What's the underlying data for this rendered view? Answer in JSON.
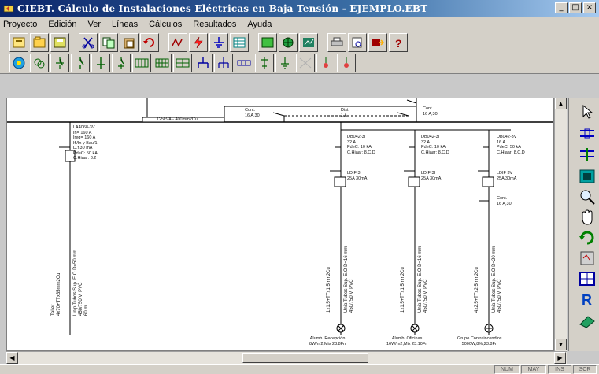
{
  "window": {
    "title": "CIEBT. Cálculo de Instalaciones Eléctricas en Baja Tensión - EJEMPLO.EBT",
    "buttons": {
      "minimize": "_",
      "maximize": "□",
      "close": "×"
    }
  },
  "menu": {
    "items": [
      "Proyecto",
      "Edición",
      "Ver",
      "Líneas",
      "Cálculos",
      "Resultados",
      "Ayuda"
    ]
  },
  "toolbar1": {
    "icons": [
      "new-doc-icon",
      "open-icon",
      "save-icon",
      "cut-icon",
      "copy-icon",
      "paste-icon",
      "undo-icon",
      "calc-icon",
      "lightning-icon",
      "ground-icon",
      "table-icon",
      "grid-icon",
      "globe-icon",
      "chart-icon",
      "print-icon",
      "preview-icon",
      "export-icon",
      "help-icon"
    ]
  },
  "toolbar2": {
    "icons": [
      "supply-icon",
      "transformer-icon",
      "switch-icon",
      "breaker-icon",
      "fuse-icon",
      "diff-icon",
      "panel-icon",
      "panel2-icon",
      "panel3-icon",
      "motor-icon",
      "motor2-icon",
      "bus-icon",
      "line-icon",
      "ground2-icon",
      "disabled-icon",
      "lamp-icon",
      "lamp2-icon"
    ]
  },
  "diagram": {
    "bus_label": "125kVA - 400mm2Cu",
    "cont_label_1": "Cont.\n16 A,30",
    "cont_label_2": "Cont.\n16 A,30",
    "dist_label": "Dist.\n1 A",
    "main_breaker": "LA4068-3V\nIn= 160 A\nIreg= 160 A\nIfi/In y Bau/1\nD.f.30 mA\nPdeC: 50 kA\nC.Hiaar: 8.2",
    "branch1_breaker": "DB042-3I\n32 A\nPdeC: 10 kA\nC.Hiaar: 8.C.D",
    "branch1_diff": "LDIF 3I\n25A 30mA",
    "branch2_breaker": "DB042-3I\n32 A\nPdeC: 10 kA\nC.Hiaar: 8.C.D",
    "branch2_diff": "LDIF 3I\n25A 30mA",
    "branch3_breaker": "DB042-3V\n16 A\nPdeC: 50 kA\nC.Hiaar: 8.C.D",
    "branch3_diff": "LDIF 3V\n25A 30mA",
    "branch3_cont": "Cont.\n16 A,30",
    "feeder_vertical_1": "Taller\n4x70+TTx35mm2Cu",
    "feeder_vertical_2": "Unip.Tubos Sup. E.O D=50 mm\n450/750 V, PVC\n60 m",
    "line_vertical_1": "1x1.5+TTx1.5mm2Cu",
    "line_vertical_2": "Unip.Tubos Sup. E.O D=16 mm\n450/750 V, PVC",
    "line_vertical_3": "1x1.5+TTx1.5mm2Cu",
    "line_vertical_4": "Unip.Tubos Sup. E.O D=16 mm\n450/750 V, PVC",
    "line_vertical_5": "4x2.5+TTx2.5mm2Cu",
    "line_vertical_6": "Unip.Tubos Sup. E.O D=20 mm\n450/750 V, PVC",
    "load_1": "Alumb. Recepción\n8W/m2,Mix 23.8Fn",
    "load_2": "Alumb. Oficinas\n16W/m2,Mix 23.10Fn",
    "load_3": "Grupo Contraincendios\n5000W,8%,23.8Fn"
  },
  "palette": {
    "icons": [
      "pointer-icon",
      "connect-icon",
      "connect2-icon",
      "component-icon",
      "zoom-icon",
      "pan-icon",
      "refresh-icon",
      "calc-icon",
      "grid-icon",
      "r-icon",
      "eraser-icon"
    ]
  },
  "status": {
    "cells": [
      "NUM",
      "MAY",
      "INS",
      "SCR"
    ]
  }
}
